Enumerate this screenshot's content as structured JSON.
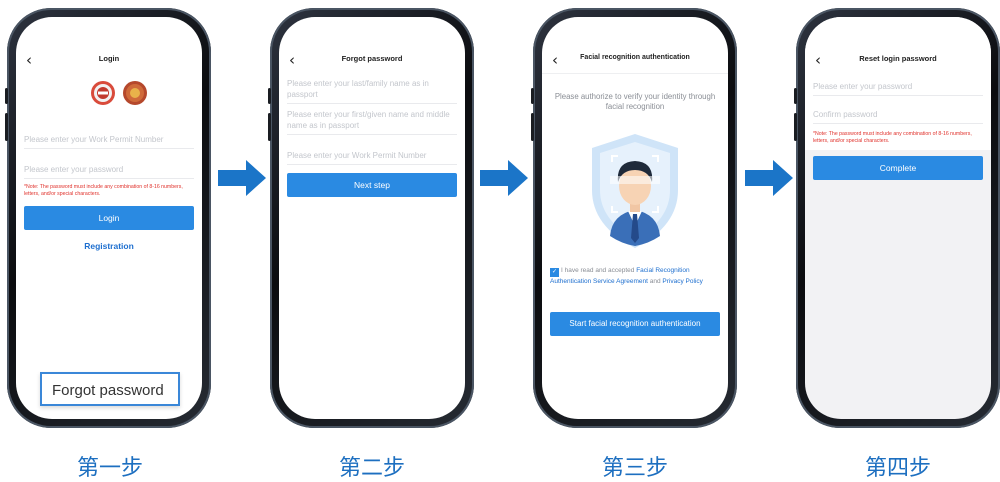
{
  "colors": {
    "primary": "#2a8ae2",
    "note": "#e0312b",
    "step": "#1d6fc0",
    "arrow": "#1b75c8"
  },
  "arrow_icon": "right-arrow-icon",
  "back_icon": "chevron-left-icon",
  "screens": [
    {
      "title": "Login",
      "fields": [
        "Please enter your Work Permit Number",
        "Please enter your password"
      ],
      "note": "*Note: The password must include any combination of 8-16 numbers, letters, and/or special characters.",
      "button": "Login",
      "link": "Registration",
      "callout": "Forgot password",
      "step": "第一步"
    },
    {
      "title": "Forgot password",
      "fields": [
        "Please enter your last/family name as in passport",
        "Please enter your first/given name and middle name as in passport",
        "Please enter your Work Permit Number"
      ],
      "button": "Next step",
      "step": "第二步"
    },
    {
      "title": "Facial recognition authentication",
      "prompt": "Please authorize to verify your identity through facial recognition",
      "agree_pre": "I have read and accepted",
      "agree_link1": "Facial Recognition Authentication Service Agreement",
      "agree_mid": "and",
      "agree_link2": "Privacy Policy",
      "checked": true,
      "button": "Start facial recognition authentication",
      "step": "第三步"
    },
    {
      "title": "Reset login password",
      "fields": [
        "Please enter your password",
        "Confirm password"
      ],
      "note": "*Note: The password must include any combination of 8-16 numbers, letters, and/or special characters.",
      "button": "Complete",
      "step": "第四步"
    }
  ]
}
